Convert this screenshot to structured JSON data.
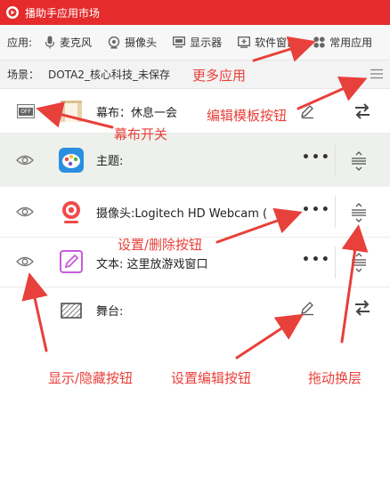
{
  "window": {
    "title": "播助手应用市场"
  },
  "apps": {
    "label": "应用:",
    "items": [
      {
        "id": "mic",
        "label": "麦克风",
        "icon": "microphone-icon"
      },
      {
        "id": "camera",
        "label": "摄像头",
        "icon": "camera-icon"
      },
      {
        "id": "display",
        "label": "显示器",
        "icon": "monitor-icon"
      },
      {
        "id": "window",
        "label": "软件窗口",
        "icon": "window-add-icon"
      },
      {
        "id": "common",
        "label": "常用应用",
        "icon": "grid-icon"
      }
    ]
  },
  "scene": {
    "label": "场景：",
    "value": "DOTA2_核心科技_未保存"
  },
  "layers": [
    {
      "id": "curtain",
      "label": "幕布：休息一会",
      "toggle_text": "OFF"
    },
    {
      "id": "theme",
      "label": "主题:"
    },
    {
      "id": "webcam",
      "label": "摄像头:Logitech HD Webcam ("
    },
    {
      "id": "text",
      "label": "文本: 这里放游戏窗口"
    },
    {
      "id": "stage",
      "label": "舞台:"
    }
  ],
  "annotations": {
    "more_apps": "更多应用",
    "edit_template": "编辑模板按钮",
    "curtain_switch": "幕布开关",
    "set_delete": "设置/删除按钮",
    "show_hide": "显示/隐藏按钮",
    "set_edit": "设置编辑按钮",
    "drag_layer": "拖动换层"
  },
  "colors": {
    "titlebar": "#e52b2b",
    "annotation": "#e8403a",
    "theme_row_bg": "#eef1eb"
  }
}
